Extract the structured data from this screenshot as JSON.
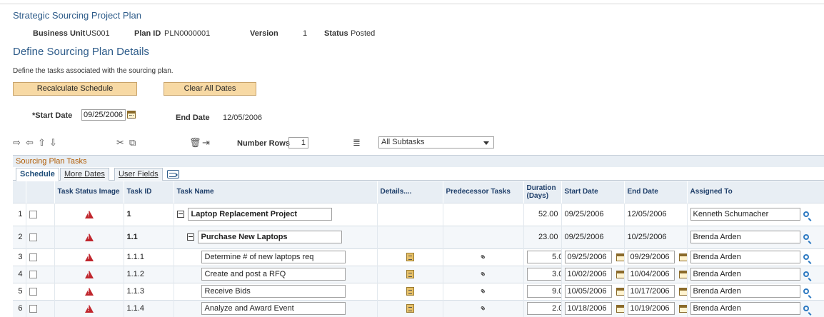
{
  "header": {
    "plan_title": "Strategic Sourcing Project Plan",
    "business_unit_label": "Business Unit",
    "business_unit_value": "US001",
    "plan_id_label": "Plan ID",
    "plan_id_value": "PLN0000001",
    "version_label": "Version",
    "version_value": "1",
    "status_label": "Status",
    "status_value": "Posted"
  },
  "page": {
    "title": "Define Sourcing Plan Details",
    "description": "Define the tasks associated with the sourcing plan."
  },
  "buttons": {
    "recalculate": "Recalculate Schedule",
    "clear_dates": "Clear All Dates"
  },
  "dates": {
    "start_label": "*Start Date",
    "start_value": "09/25/2006",
    "end_label": "End Date",
    "end_value": "12/05/2006"
  },
  "toolbar": {
    "number_rows_label": "Number Rows",
    "number_rows_value": "1",
    "subtasks_option": "All Subtasks"
  },
  "grid": {
    "title": "Sourcing Plan Tasks",
    "tabs": [
      "Schedule",
      "More Dates",
      "User Fields"
    ],
    "columns": [
      "Task Status Image",
      "Task ID",
      "Task Name",
      "Details....",
      "Predecessor Tasks",
      "Duration (Days)",
      "Start Date",
      "End Date",
      "Assigned To"
    ],
    "rows": [
      {
        "num": "1",
        "id": "1",
        "name": "Laptop Replacement Project",
        "duration": "52.00",
        "start": "09/25/2006",
        "end": "12/05/2006",
        "assigned": "Kenneth Schumacher"
      },
      {
        "num": "2",
        "id": "1.1",
        "name": "Purchase New Laptops",
        "duration": "23.00",
        "start": "09/25/2006",
        "end": "10/25/2006",
        "assigned": "Brenda Arden"
      },
      {
        "num": "3",
        "id": "1.1.1",
        "name": "Determine # of new laptops req",
        "duration": "5.00",
        "start": "09/25/2006",
        "end": "09/29/2006",
        "assigned": "Brenda Arden"
      },
      {
        "num": "4",
        "id": "1.1.2",
        "name": "Create and post a RFQ",
        "duration": "3.00",
        "start": "10/02/2006",
        "end": "10/04/2006",
        "assigned": "Brenda Arden"
      },
      {
        "num": "5",
        "id": "1.1.3",
        "name": "Receive Bids",
        "duration": "9.00",
        "start": "10/05/2006",
        "end": "10/17/2006",
        "assigned": "Brenda Arden"
      },
      {
        "num": "6",
        "id": "1.1.4",
        "name": "Analyze and Award Event",
        "duration": "2.00",
        "start": "10/18/2006",
        "end": "10/19/2006",
        "assigned": "Brenda Arden"
      }
    ]
  }
}
